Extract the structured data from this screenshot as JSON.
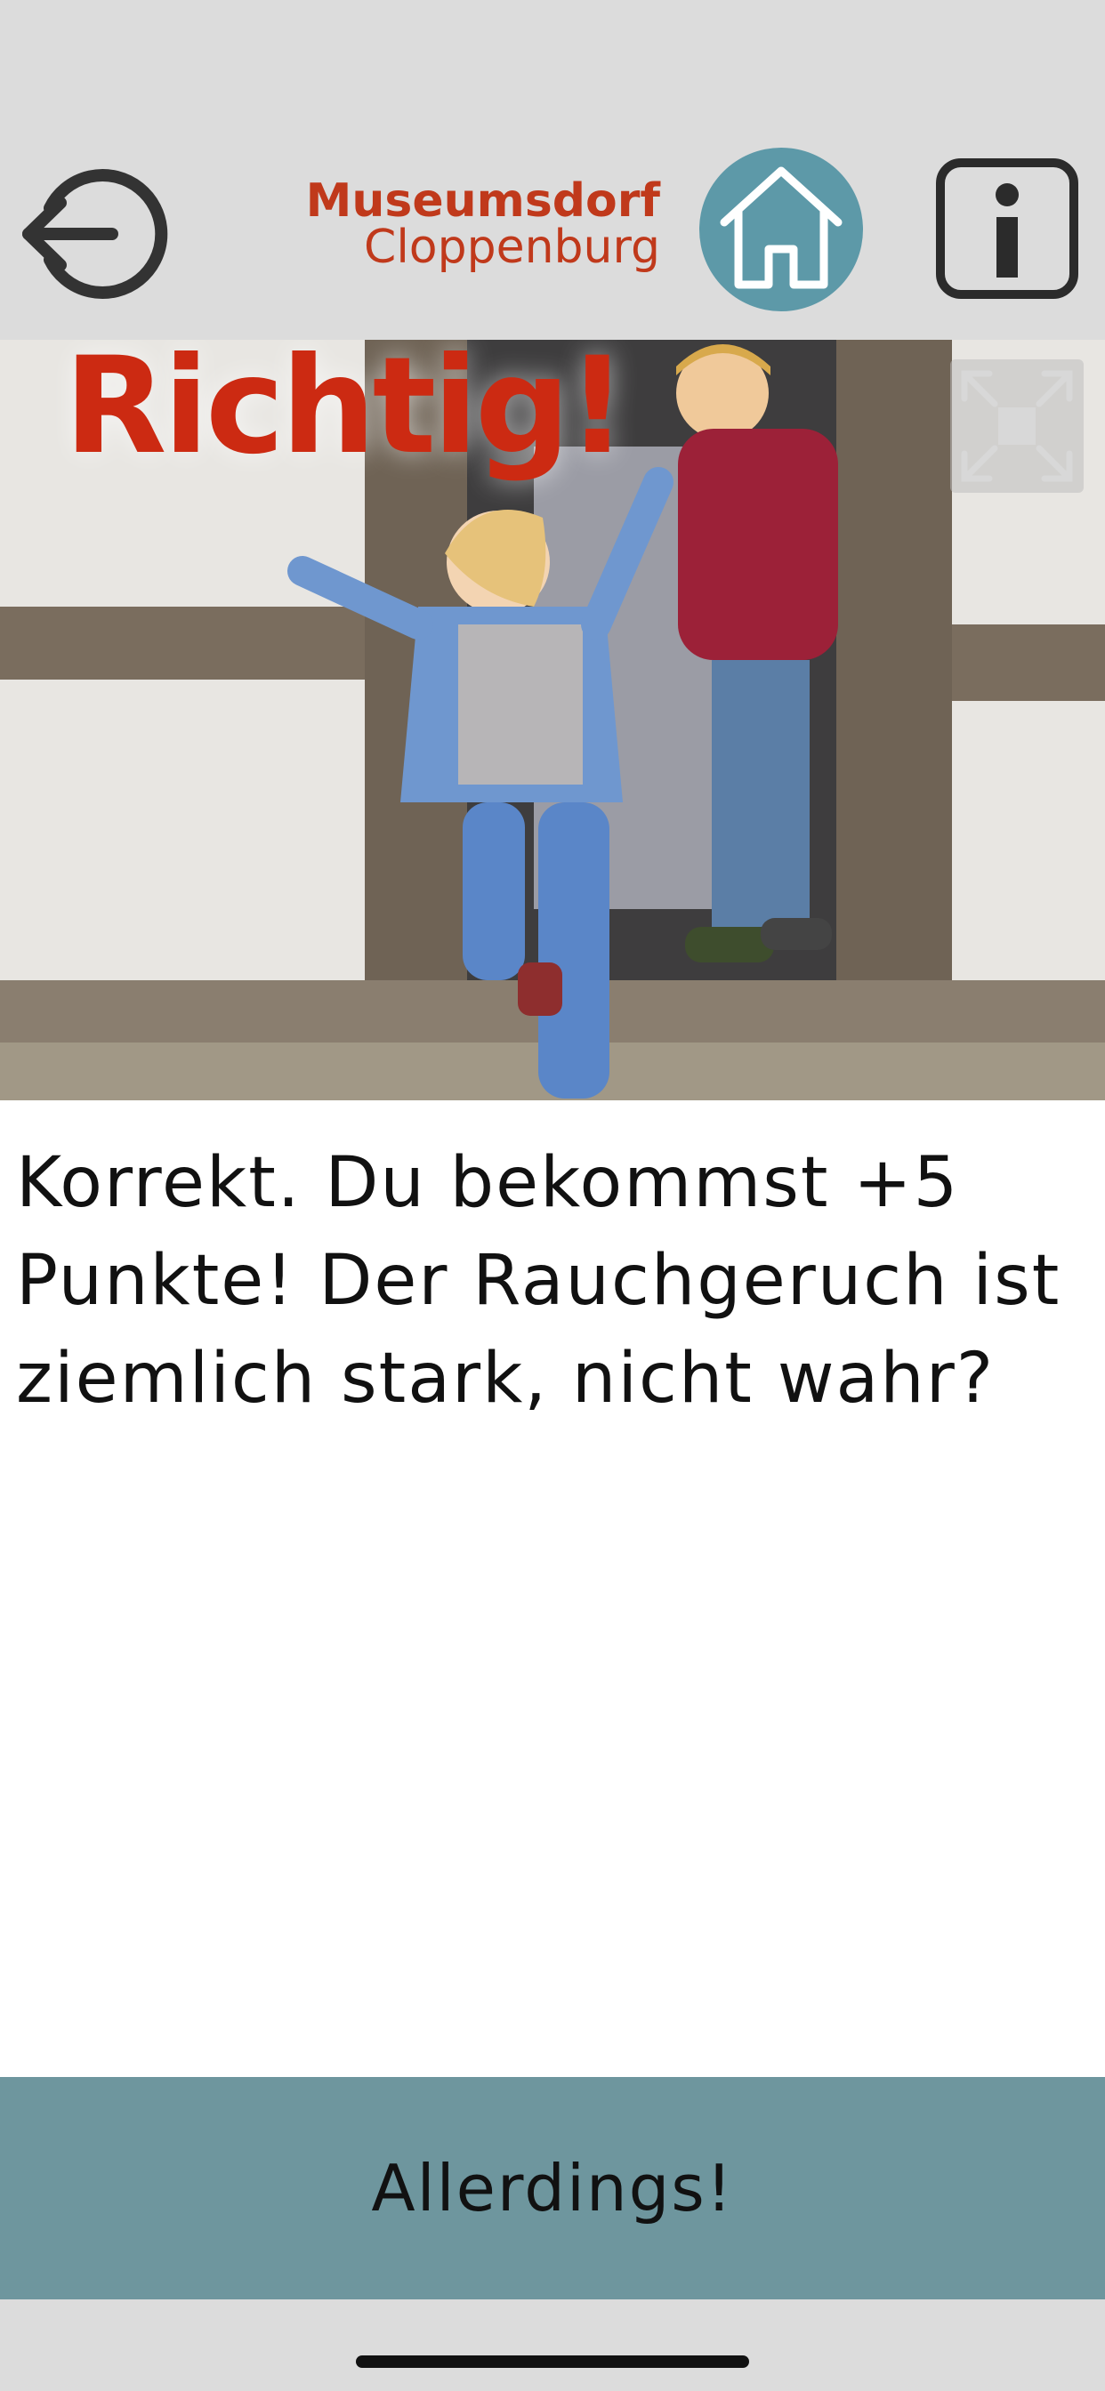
{
  "header": {
    "back_icon": "logout-arrow-icon",
    "logo": {
      "line1": "Museumsdorf",
      "line2": "Cloppenburg"
    },
    "home_icon": "house-icon",
    "info_icon": "info-icon"
  },
  "photo": {
    "caption": "Richtig!",
    "fullscreen_icon": "expand-icon"
  },
  "message": {
    "text": "Korrekt. Du bekommst +5 Punkte! Der Rauchgeruch ist ziemlich stark, nicht wahr?"
  },
  "answer_button": {
    "label": "Allerdings!"
  },
  "colors": {
    "header_bg": "#dcdcdc",
    "logo_red": "#c0391b",
    "home_teal": "#5d99a8",
    "button_teal": "#6e969e",
    "caption_red": "#cc2a12"
  }
}
